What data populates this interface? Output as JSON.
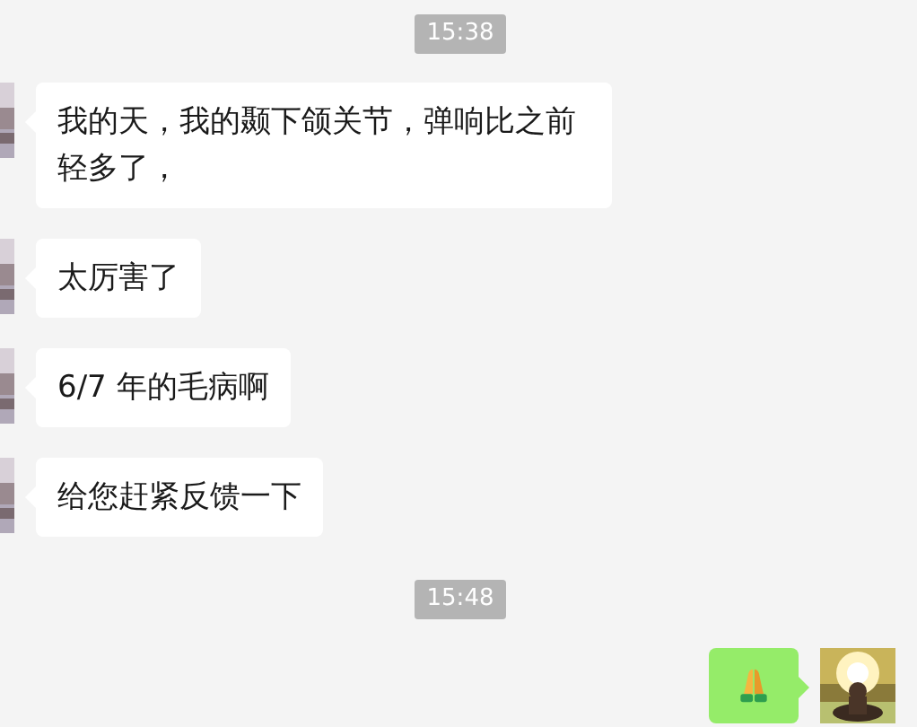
{
  "messages": [
    {
      "kind": "time",
      "text": "15:38"
    },
    {
      "kind": "text",
      "outgoing": false,
      "text": "我的天，我的颞下颌关节，弹响比之前轻多了，"
    },
    {
      "kind": "text",
      "outgoing": false,
      "text": "太厉害了"
    },
    {
      "kind": "text",
      "outgoing": false,
      "text": "6/7 年的毛病啊"
    },
    {
      "kind": "text",
      "outgoing": false,
      "text": "给您赶紧反馈一下"
    },
    {
      "kind": "time",
      "text": "15:48"
    },
    {
      "kind": "emoji",
      "outgoing": true
    }
  ]
}
